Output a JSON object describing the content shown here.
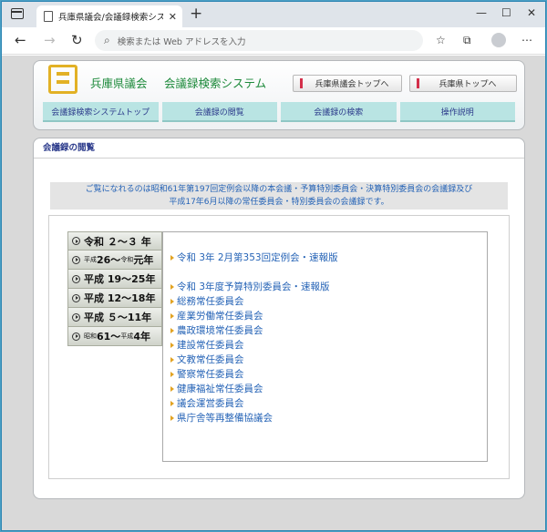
{
  "browser": {
    "tab_title": "兵庫県議会/会議録検索システム",
    "tab_close": "✕",
    "new_tab": "+",
    "address_placeholder": "検索または Web アドレスを入力",
    "controls": {
      "minimize": "—",
      "maximize": "☐",
      "close": "✕"
    }
  },
  "header": {
    "site_name": "兵庫県議会",
    "system_name": "会議録検索システム",
    "buttons": [
      "兵庫県議会トップへ",
      "兵庫県トップへ"
    ],
    "nav": [
      "会議録検索システムトップ",
      "会議録の閲覧",
      "会議録の検索",
      "操作説明"
    ]
  },
  "content": {
    "section_title": "会議録の閲覧",
    "notice_line1": "ご覧になれるのは昭和61年第197回定例会以降の本会議・予算特別委員会・決算特別委員会の会議録及び",
    "notice_line2": "平成17年6月以降の常任委員会・特別委員会の会議録です。",
    "periods": [
      {
        "era1": "令和",
        "y1": "２～３",
        "era2": "",
        "y2": "",
        "suffix": "年"
      },
      {
        "era1": "平成",
        "y1": "26～",
        "era2": "令和",
        "y2": "元",
        "suffix": "年"
      },
      {
        "era1": "平成",
        "y1": "19～25",
        "era2": "",
        "y2": "",
        "suffix": "年"
      },
      {
        "era1": "平成",
        "y1": "12～18",
        "era2": "",
        "y2": "",
        "suffix": "年"
      },
      {
        "era1": "平成",
        "y1": "５～11",
        "era2": "",
        "y2": "",
        "suffix": "年"
      },
      {
        "era1": "昭和",
        "y1": "61～",
        "era2": "平成",
        "y2": "4",
        "suffix": "年"
      }
    ],
    "links": [
      "令和 3年 2月第353回定例会・速報版",
      "令和 3年度予算特別委員会・速報版",
      "総務常任委員会",
      "産業労働常任委員会",
      "農政環境常任委員会",
      "建設常任委員会",
      "文教常任委員会",
      "警察常任委員会",
      "健康福祉常任委員会",
      "議会運営委員会",
      "県庁舎等再整備協議会"
    ]
  }
}
